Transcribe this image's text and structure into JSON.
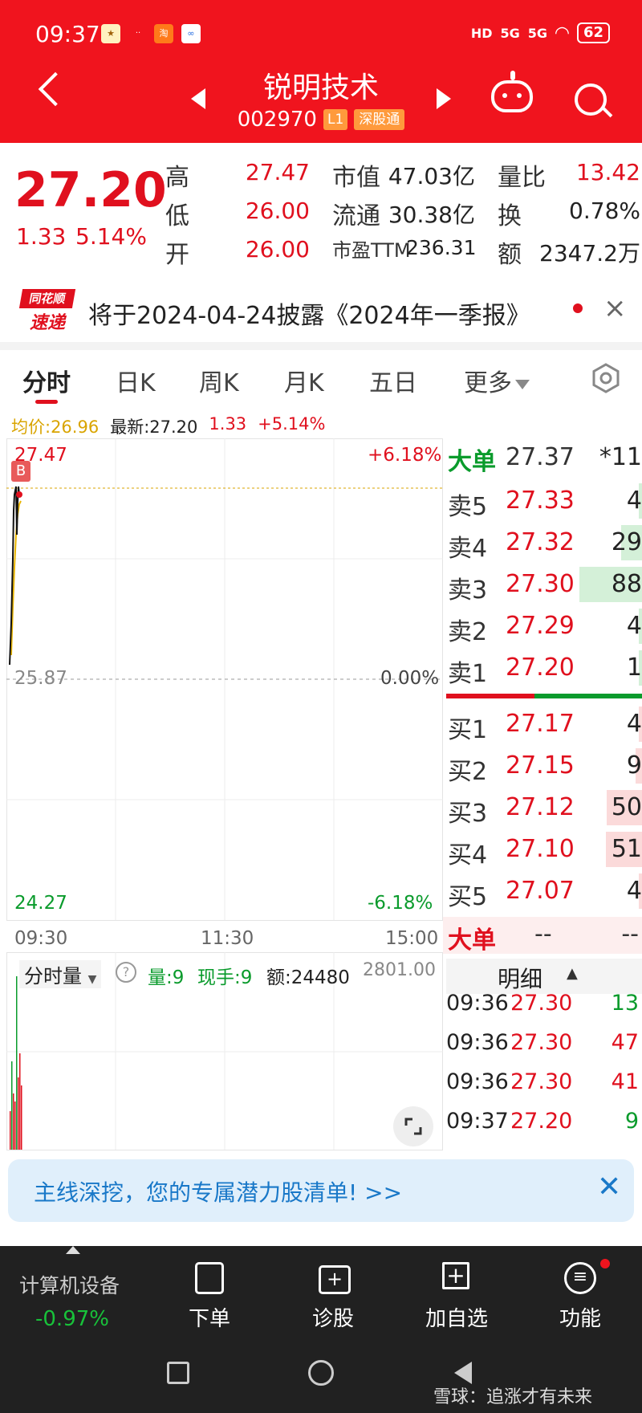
{
  "status": {
    "time": "09:37",
    "network1": "HD",
    "network2": "5G",
    "network3": "5G",
    "battery": "62"
  },
  "header": {
    "name": "锐明技术",
    "code": "002970",
    "level": "L1",
    "connect": "深股通"
  },
  "quote": {
    "price": "27.20",
    "change": "1.33",
    "change_pct": "5.14%",
    "high_label": "高",
    "high": "27.47",
    "low_label": "低",
    "low": "26.00",
    "open_label": "开",
    "open": "26.00",
    "mcap_label": "市值",
    "mcap": "47.03亿",
    "float_label": "流通",
    "float": "30.38亿",
    "pe_label": "市盈TTM",
    "pe": "236.31",
    "vr_label": "量比",
    "vr": "13.42",
    "turn_label": "换",
    "turn": "0.78%",
    "amt_label": "额",
    "amt": "2347.2万"
  },
  "notice": {
    "logo_top": "同花顺",
    "logo_bottom": "速递",
    "text": "将于2024-04-24披露《2024年一季报》",
    "close": "×"
  },
  "tabs": [
    "分时",
    "日K",
    "周K",
    "月K",
    "五日",
    "更多"
  ],
  "info": {
    "avg": "均价:26.96",
    "latest": "最新:27.20",
    "chg": "1.33",
    "pct": "+5.14%"
  },
  "chart": {
    "y_top": "27.47",
    "y_mid": "25.87",
    "y_bot": "24.27",
    "pct_top": "+6.18%",
    "pct_mid": "0.00%",
    "pct_bot": "-6.18%",
    "x_start": "09:30",
    "x_mid": "11:30",
    "x_end": "15:00",
    "b_marker": "B"
  },
  "volume": {
    "label": "分时量",
    "help": "?",
    "vol": "量:9",
    "hand": "现手:9",
    "amount": "额:24480",
    "max": "2801.00"
  },
  "orderbook": {
    "big_label": "大单",
    "big_price": "27.37",
    "big_vol": "*11",
    "asks": [
      {
        "label": "卖5",
        "price": "27.33",
        "vol": "4",
        "bar": 0.05
      },
      {
        "label": "卖4",
        "price": "27.32",
        "vol": "29",
        "bar": 0.33
      },
      {
        "label": "卖3",
        "price": "27.30",
        "vol": "88",
        "bar": 1.0
      },
      {
        "label": "卖2",
        "price": "27.29",
        "vol": "4",
        "bar": 0.05
      },
      {
        "label": "卖1",
        "price": "27.20",
        "vol": "1",
        "bar": 0.02
      }
    ],
    "bids": [
      {
        "label": "买1",
        "price": "27.17",
        "vol": "4",
        "bar": 0.05
      },
      {
        "label": "买2",
        "price": "27.15",
        "vol": "9",
        "bar": 0.1
      },
      {
        "label": "买3",
        "price": "27.12",
        "vol": "50",
        "bar": 0.57
      },
      {
        "label": "买4",
        "price": "27.10",
        "vol": "51",
        "bar": 0.58
      },
      {
        "label": "买5",
        "price": "27.07",
        "vol": "4",
        "bar": 0.05
      }
    ],
    "big2_label": "大单",
    "big2_a": "--",
    "big2_b": "--",
    "detail_label": "明细"
  },
  "ticks": [
    {
      "time": "09:36",
      "price": "27.30",
      "vol": "13",
      "dir": "green"
    },
    {
      "time": "09:36",
      "price": "27.30",
      "vol": "47",
      "dir": "red"
    },
    {
      "time": "09:36",
      "price": "27.30",
      "vol": "41",
      "dir": "red"
    },
    {
      "time": "09:37",
      "price": "27.20",
      "vol": "9",
      "dir": "green"
    }
  ],
  "banner": {
    "text": "主线深挖，您的专属潜力股清单! >>",
    "close": "✕"
  },
  "bottom": {
    "sector": "计算机设备",
    "sector_pct": "-0.97%",
    "items": [
      "下单",
      "诊股",
      "加自选",
      "功能"
    ]
  },
  "watermark": "雪球：追涨才有未来"
}
